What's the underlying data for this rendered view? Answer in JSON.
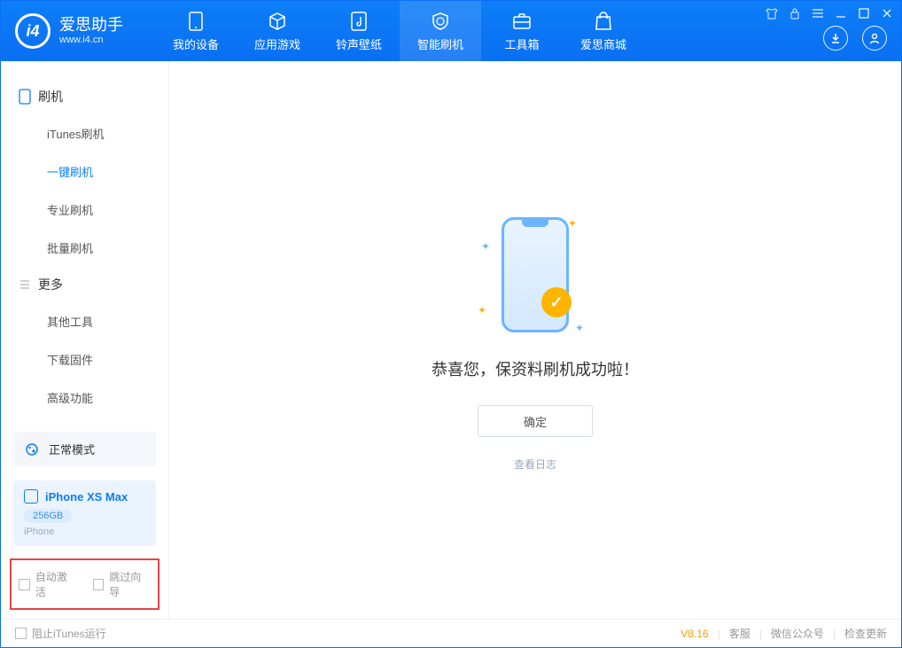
{
  "brand": {
    "name": "爱思助手",
    "url": "www.i4.cn"
  },
  "tabs": {
    "device": "我的设备",
    "apps": "应用游戏",
    "ringtone": "铃声壁纸",
    "flash": "智能刷机",
    "toolbox": "工具箱",
    "store": "爱思商城"
  },
  "sidebar": {
    "section1": "刷机",
    "items1": {
      "itunes": "iTunes刷机",
      "onekey": "一键刷机",
      "pro": "专业刷机",
      "batch": "批量刷机"
    },
    "section2": "更多",
    "items2": {
      "other": "其他工具",
      "firmware": "下载固件",
      "advanced": "高级功能"
    }
  },
  "mode": {
    "label": "正常模式"
  },
  "device": {
    "name": "iPhone XS Max",
    "capacity": "256GB",
    "type": "iPhone"
  },
  "checkboxes": {
    "autoActivate": "自动激活",
    "skipWizard": "跳过向导"
  },
  "main": {
    "successText": "恭喜您，保资料刷机成功啦！",
    "confirm": "确定",
    "viewLog": "查看日志"
  },
  "footer": {
    "blockItunes": "阻止iTunes运行",
    "version": "V8.16",
    "service": "客服",
    "wechat": "微信公众号",
    "update": "检查更新"
  }
}
